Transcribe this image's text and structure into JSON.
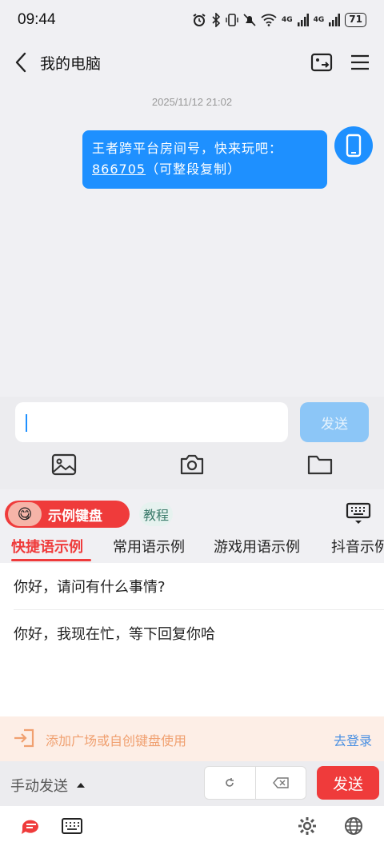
{
  "status_bar": {
    "time": "09:44",
    "network_label_1": "4G",
    "network_label_2": "4G",
    "battery_level": "71"
  },
  "nav": {
    "title": "我的电脑"
  },
  "chat": {
    "timestamp": "2025/11/12 21:02",
    "message_prefix": "王者跨平台房间号，快来玩吧：",
    "room_code": "866705",
    "message_suffix": "（可整段复制）"
  },
  "composer": {
    "input_value": "",
    "send_label": "发送"
  },
  "keyboard": {
    "badge_label": "示例键盘",
    "badge_emoji": "😋",
    "tutorial_label": "教程",
    "tabs": [
      {
        "label": "快捷语示例",
        "active": true
      },
      {
        "label": "常用语示例",
        "active": false
      },
      {
        "label": "游戏用语示例",
        "active": false
      },
      {
        "label": "抖音示例",
        "active": false
      }
    ],
    "phrases": [
      "你好，请问有什么事情?",
      "你好，我现在忙，等下回复你哈"
    ],
    "login_banner": {
      "text": "添加广场或自创键盘使用",
      "link": "去登录"
    },
    "footer": {
      "manual_send_label": "手动发送",
      "send_label": "发送"
    }
  },
  "colors": {
    "accent_red": "#ef3b3b",
    "bubble_blue": "#1e90ff",
    "send_disabled": "#8cc6f7",
    "link_blue": "#4a90e2",
    "banner_text": "#f0a070"
  }
}
